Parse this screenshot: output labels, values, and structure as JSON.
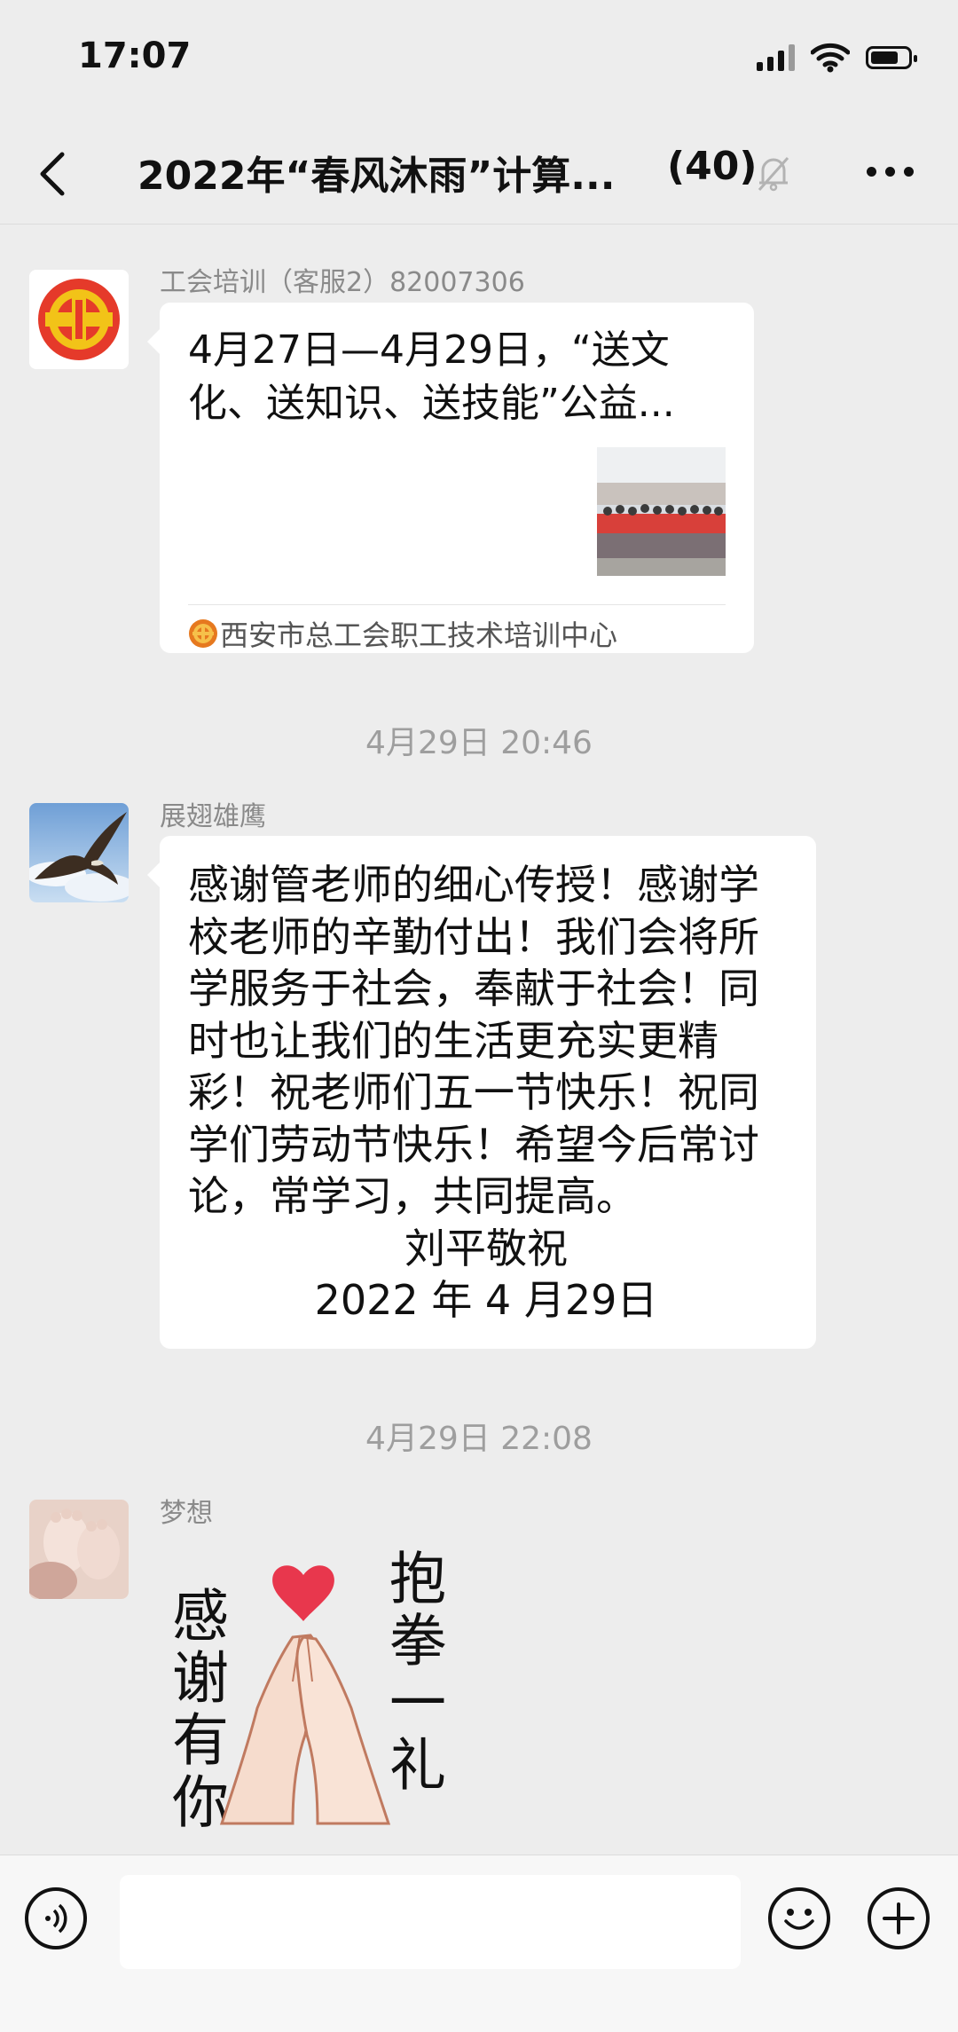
{
  "status": {
    "time": "17:07"
  },
  "header": {
    "title": "2022年“春风沐雨”计算...",
    "member_count": "(40)"
  },
  "messages": [
    {
      "sender": "工会培训（客服2）82007306",
      "card": {
        "title": "4月27日—4月29日，“送文化、送知识、送技能”公益...",
        "source": "西安市总工会职工技术培训中心"
      }
    },
    {
      "time": "4月29日 20:46",
      "sender": "展翅雄鹰",
      "text": "感谢管老师的细心传授！感谢学校老师的辛勤付出！我们会将所学服务于社会，奉献于社会！同时也让我们的生活更充实更精彩！祝老师们五一节快乐！祝同学们劳动节快乐！希望今后常讨论，常学习，共同提高。",
      "signature": "刘平敬祝",
      "date": "2022 年 4 月29日"
    },
    {
      "time": "4月29日 22:08",
      "sender": "梦想",
      "sticker": {
        "left": "感谢有你",
        "right": "抱拳一礼"
      }
    }
  ],
  "colors": {
    "background": "#ededed",
    "bubble": "#ffffff",
    "union_red": "#e53a2a",
    "union_yellow": "#f2c318",
    "heart": "#e8374d"
  },
  "icons": [
    "chevron-left-icon",
    "mute-bell-icon",
    "more-icon",
    "voice-icon",
    "emoji-icon",
    "plus-icon"
  ]
}
